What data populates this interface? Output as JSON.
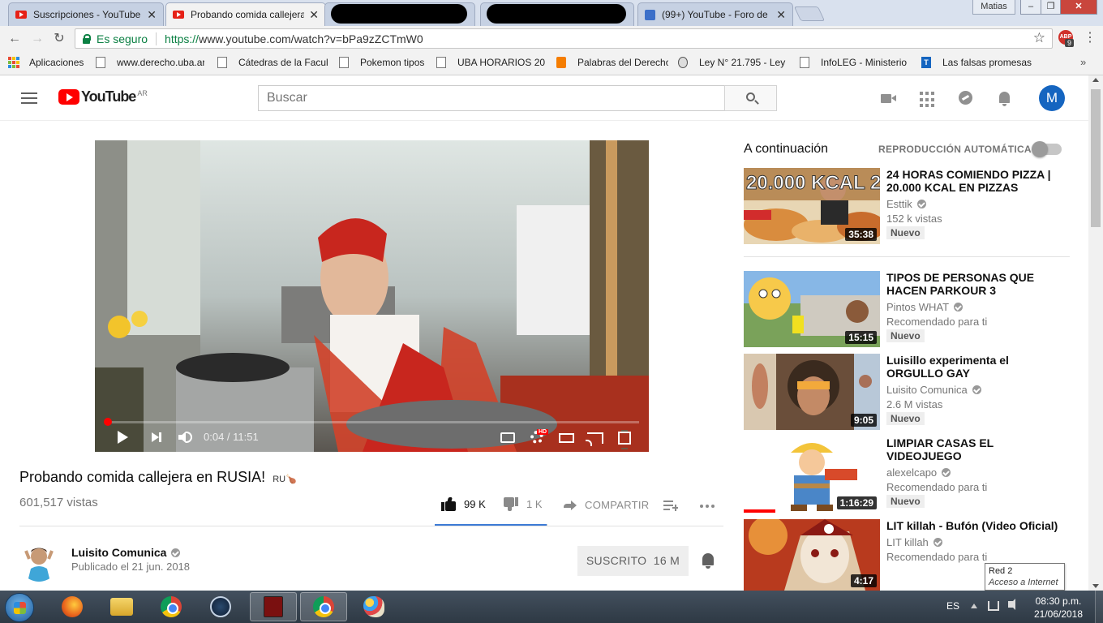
{
  "browser": {
    "tabs": [
      {
        "label": "Suscripciones - YouTube",
        "icon": "youtube-icon"
      },
      {
        "label": "Probando comida callejera",
        "icon": "youtube-icon",
        "active": true
      },
      {
        "label": "",
        "icon": "redacted"
      },
      {
        "label": "",
        "icon": "redacted"
      },
      {
        "label": "(99+) YouTube - Foro de",
        "icon": "forum-icon"
      }
    ],
    "user_name": "Matias",
    "window_controls": {
      "minimize": "–",
      "maximize": "❐",
      "close": "✕"
    },
    "secure_label": "Es seguro",
    "url_protocol": "https://",
    "url_rest": "www.youtube.com/watch?v=bPa9zZCTmW0",
    "extension_label": "ABP",
    "extension_badge": "9",
    "bookmarks": [
      "Aplicaciones",
      "www.derecho.uba.ar",
      "Cátedras de la Facult",
      "Pokemon tipos",
      "UBA HORARIOS 201",
      "Palabras del Derecho",
      "Ley N° 21.795 - Ley d",
      "InfoLEG - Ministerio",
      "Las falsas promesas"
    ],
    "bookmarks_more": "»"
  },
  "youtube": {
    "logo_text": "YouTube",
    "country": "AR",
    "search_placeholder": "Buscar",
    "avatar_letter": "M"
  },
  "player": {
    "current_time": "0:04",
    "duration": "11:51",
    "time_display": "0:04 / 11:51",
    "progress_fraction": 0.006,
    "hd_badge": "HD"
  },
  "video": {
    "title": "Probando comida callejera en RUSIA!",
    "title_suffix": "RU🍗",
    "views": "601,517 vistas",
    "likes": "99 K",
    "dislikes": "1 K",
    "like_ratio": 0.99,
    "share_label": "COMPARTIR",
    "channel_name": "Luisito Comunica",
    "publish_date": "Publicado el 21 jun. 2018",
    "subscribe_label": "SUSCRITO",
    "subscriber_count": "16 M"
  },
  "sidebar": {
    "up_next": "A continuación",
    "autoplay_label": "REPRODUCCIÓN AUTOMÁTICA",
    "autoplay_on": false,
    "recommendations": [
      {
        "title": "24 HORAS COMIENDO PIZZA | 20.000 KCAL EN PIZZAS",
        "channel": "Esttik",
        "meta": "152 k vistas",
        "badge": "Nuevo",
        "duration": "35:38",
        "thumb_text": "20.000 KCAL 24H"
      },
      {
        "title": "TIPOS DE PERSONAS QUE HACEN PARKOUR 3",
        "channel": "Pintos WHAT",
        "meta": "Recomendado para ti",
        "badge": "Nuevo",
        "duration": "15:15"
      },
      {
        "title": "Luisillo experimenta el ORGULLO GAY",
        "channel": "Luisito Comunica",
        "meta": "2.6 M vistas",
        "badge": "Nuevo",
        "duration": "9:05"
      },
      {
        "title": "LIMPIAR CASAS EL VIDEOJUEGO",
        "channel": "alexelcapo",
        "meta": "Recomendado para ti",
        "badge": "Nuevo",
        "duration": "1:16:29",
        "watched_fraction": 0.23
      },
      {
        "title": "LIT killah - Bufón (Video Oficial)",
        "channel": "LIT killah",
        "meta": "Recomendado para ti",
        "duration": "4:17"
      }
    ]
  },
  "tooltip": {
    "line1": "Red  2",
    "line2": "Acceso a Internet"
  },
  "taskbar": {
    "language": "ES",
    "time": "08:30 p.m.",
    "date": "21/06/2018"
  }
}
